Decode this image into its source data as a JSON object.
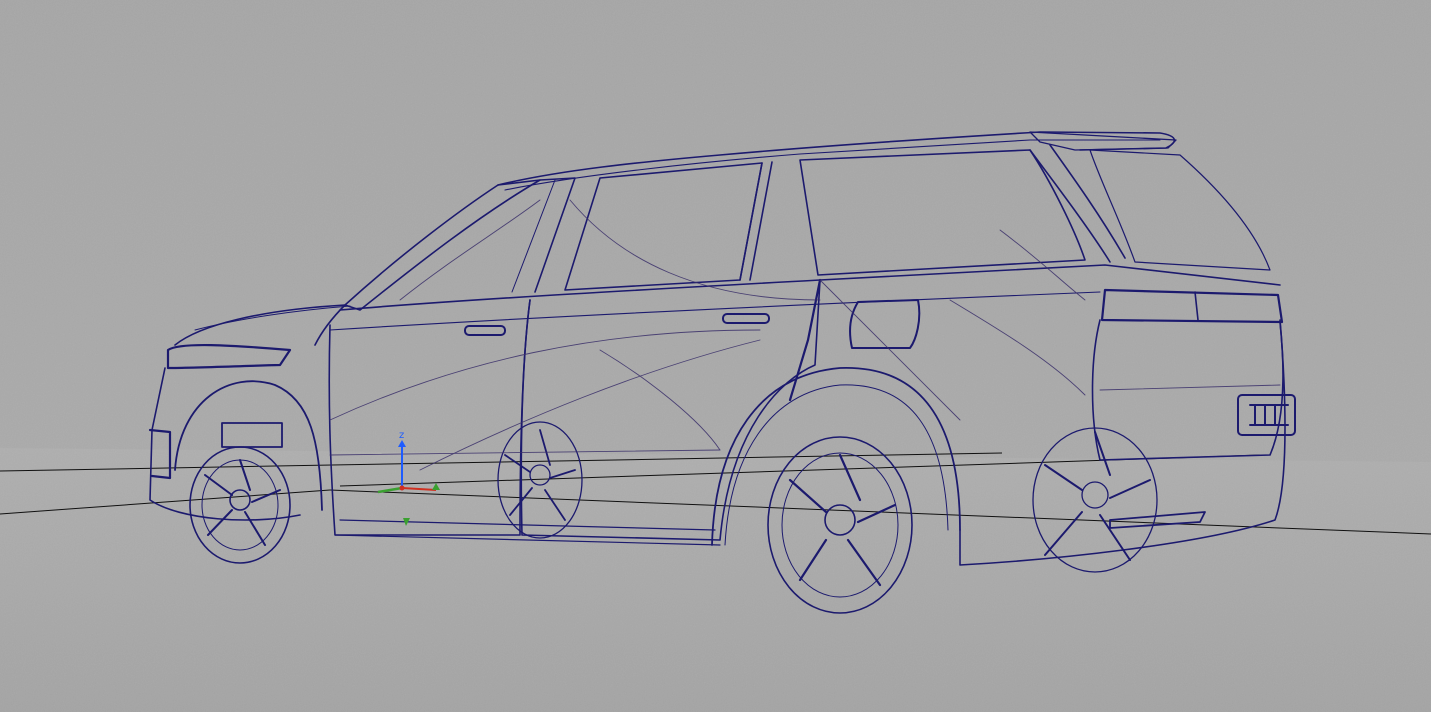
{
  "viewport": {
    "background_color": "#a9a9a9",
    "floor_color": "#a5a5a5",
    "wire_color": "#1c1a6e",
    "wire_secondary_color": "#3a2f6a",
    "axis_line_color": "#101010"
  },
  "gizmo": {
    "z_label": "z",
    "x_color": "#d03020",
    "y_color": "#3aa030",
    "z_color": "#1e5cff"
  },
  "model": {
    "label": "vehicle-wireframe",
    "view_mode": "wireframe"
  }
}
